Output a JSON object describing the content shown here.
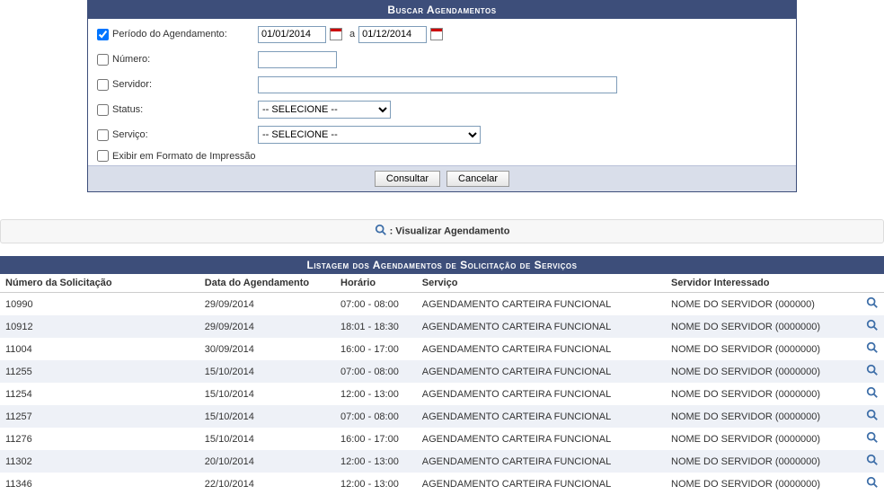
{
  "search": {
    "title": "Buscar Agendamentos",
    "periodo": {
      "label": "Período do Agendamento:",
      "start": "01/01/2014",
      "end": "01/12/2014",
      "sep": "a"
    },
    "numero": {
      "label": "Número:",
      "value": ""
    },
    "servidor": {
      "label": "Servidor:",
      "value": ""
    },
    "status": {
      "label": "Status:",
      "selected": "-- SELECIONE --"
    },
    "servico": {
      "label": "Serviço:",
      "selected": "-- SELECIONE --"
    },
    "print": {
      "label": "Exibir em Formato de Impressão"
    },
    "btn_consultar": "Consultar",
    "btn_cancelar": "Cancelar"
  },
  "legend": {
    "text": ": Visualizar Agendamento"
  },
  "list": {
    "title": "Listagem dos Agendamentos de Solicitação de Serviços",
    "headers": {
      "numero": "Número da Solicitação",
      "data": "Data do Agendamento",
      "horario": "Horário",
      "servico": "Serviço",
      "servidor": "Servidor Interessado"
    },
    "rows": [
      {
        "numero": "10990",
        "data": "29/09/2014",
        "horario": "07:00 - 08:00",
        "servico": "AGENDAMENTO CARTEIRA FUNCIONAL",
        "servidor": "NOME DO SERVIDOR (000000)"
      },
      {
        "numero": "10912",
        "data": "29/09/2014",
        "horario": "18:01 - 18:30",
        "servico": "AGENDAMENTO CARTEIRA FUNCIONAL",
        "servidor": "NOME DO SERVIDOR (0000000)"
      },
      {
        "numero": "11004",
        "data": "30/09/2014",
        "horario": "16:00 - 17:00",
        "servico": "AGENDAMENTO CARTEIRA FUNCIONAL",
        "servidor": "NOME DO SERVIDOR (0000000)"
      },
      {
        "numero": "11255",
        "data": "15/10/2014",
        "horario": "07:00 - 08:00",
        "servico": "AGENDAMENTO CARTEIRA FUNCIONAL",
        "servidor": "NOME DO SERVIDOR (0000000)"
      },
      {
        "numero": "11254",
        "data": "15/10/2014",
        "horario": "12:00 - 13:00",
        "servico": "AGENDAMENTO CARTEIRA FUNCIONAL",
        "servidor": "NOME DO SERVIDOR (0000000)"
      },
      {
        "numero": "11257",
        "data": "15/10/2014",
        "horario": "07:00 - 08:00",
        "servico": "AGENDAMENTO CARTEIRA FUNCIONAL",
        "servidor": "NOME DO SERVIDOR (0000000)"
      },
      {
        "numero": "11276",
        "data": "15/10/2014",
        "horario": "16:00 - 17:00",
        "servico": "AGENDAMENTO CARTEIRA FUNCIONAL",
        "servidor": "NOME DO SERVIDOR (0000000)"
      },
      {
        "numero": "11302",
        "data": "20/10/2014",
        "horario": "12:00 - 13:00",
        "servico": "AGENDAMENTO CARTEIRA FUNCIONAL",
        "servidor": "NOME DO SERVIDOR (0000000)"
      },
      {
        "numero": "11346",
        "data": "22/10/2014",
        "horario": "12:00 - 13:00",
        "servico": "AGENDAMENTO CARTEIRA FUNCIONAL",
        "servidor": "NOME DO SERVIDOR (0000000)"
      }
    ]
  }
}
